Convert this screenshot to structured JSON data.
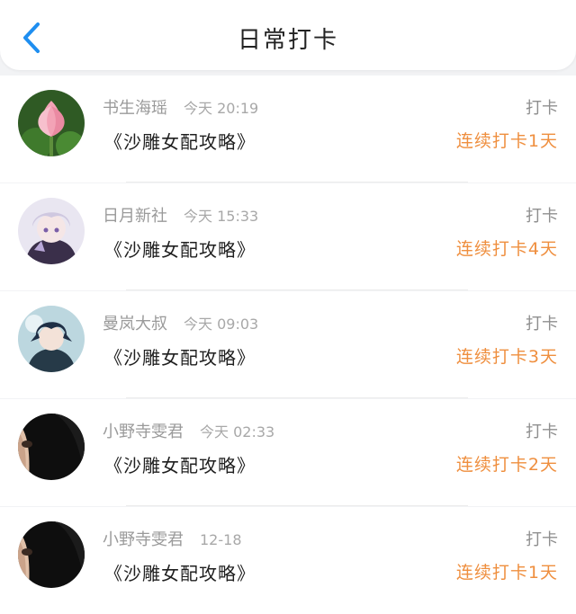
{
  "header": {
    "title": "日常打卡",
    "back_icon": "chevron-left-icon",
    "accent": "#1e8ef0"
  },
  "rows": [
    {
      "name": "书生海瑶",
      "time": "今天 20:19",
      "action": "打卡",
      "book": "《沙雕女配攻略》",
      "streak": "连续打卡1天",
      "avatar": "lotus-flower-photo"
    },
    {
      "name": "日月新社",
      "time": "今天 15:33",
      "action": "打卡",
      "book": "《沙雕女配攻略》",
      "streak": "连续打卡4天",
      "avatar": "anime-boy-white-hair"
    },
    {
      "name": "曼岚大叔",
      "time": "今天 09:03",
      "action": "打卡",
      "book": "《沙雕女配攻略》",
      "streak": "连续打卡3天",
      "avatar": "anime-boy-dark-hair"
    },
    {
      "name": "小野寺雯君",
      "time": "今天 02:33",
      "action": "打卡",
      "book": "《沙雕女配攻略》",
      "streak": "连续打卡2天",
      "avatar": "dark-face-photo"
    },
    {
      "name": "小野寺雯君",
      "time": "12-18",
      "action": "打卡",
      "book": "《沙雕女配攻略》",
      "streak": "连续打卡1天",
      "avatar": "dark-face-photo"
    }
  ],
  "colors": {
    "streak": "#ef8f3f",
    "name": "#9a9a9a",
    "background": "#f2f3f5"
  }
}
